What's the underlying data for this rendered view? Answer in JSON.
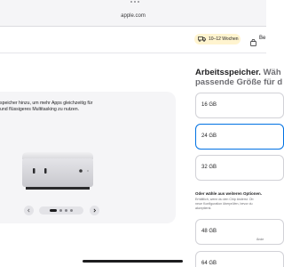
{
  "browser": {
    "url": "apple.com"
  },
  "header": {
    "delivery_badge": "10–12 Wochen",
    "bag_label": "Be"
  },
  "gallery": {
    "caption_line1": "speicher hinzu, um mehr Apps gleichzeitig für",
    "caption_line2": "und flüssigeres Multitasking zu nutzen.",
    "dots_count": 4,
    "active_dot": 1
  },
  "memory": {
    "title_strong": "Arbeitsspeicher.",
    "title_muted": "Wäh",
    "title_line2": "passende Größe für d",
    "options": [
      {
        "label": "16 GB",
        "selected": false,
        "extra": ""
      },
      {
        "label": "24 GB",
        "selected": true,
        "extra": ""
      },
      {
        "label": "32 GB",
        "selected": false,
        "extra": ""
      },
      {
        "label": "48 GB",
        "selected": false,
        "extra": "Ände"
      },
      {
        "label": "64 GB",
        "selected": false,
        "extra": ""
      }
    ],
    "more_options_title": "Oder wähle aus weiteren Optionen.",
    "more_options_text_1": "Erhältlich, wenn du den Chip änderst. Ob",
    "more_options_text_2": "neue Konfiguration überprüfen, bevor du",
    "more_options_text_3": "akzeptierst."
  },
  "colors": {
    "accent": "#0071e3",
    "badge_bg": "#fff4cf",
    "card_bg": "#f5f5f7"
  }
}
